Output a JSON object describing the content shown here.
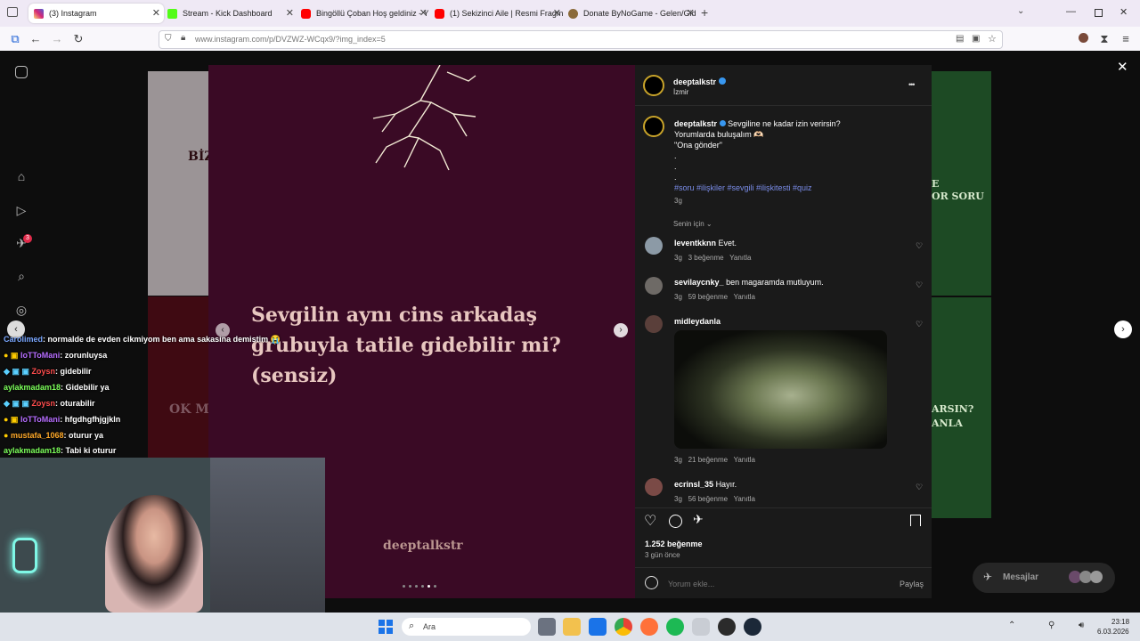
{
  "tabs": [
    {
      "label": "(3) Instagram",
      "icon": "instagram-icon",
      "color": "#d62976"
    },
    {
      "label": "Stream - Kick Dashboard",
      "icon": "kick-icon",
      "color": "#53fc18"
    },
    {
      "label": "Bingöllü Çoban Hoş geldiniz - Y",
      "icon": "youtube-icon",
      "color": "#ff0000"
    },
    {
      "label": "(1) Sekizinci Aile | Resmi Fragm",
      "icon": "youtube-icon",
      "color": "#ff0000"
    },
    {
      "label": "Donate ByNoGame - Gelen/Gid",
      "icon": "bynogame-icon",
      "color": "#8a6a3a"
    }
  ],
  "url": "www.instagram.com/p/DVZWZ-WCqx9/?img_index=5",
  "post": {
    "question": "Sevgilin aynı cins arkadaş grubuyla tatile gidebilir mi? (sensiz)",
    "brand": "deeptalkstr",
    "carousel_index": 5,
    "carousel_total": 6
  },
  "header": {
    "username": "deeptalkstr",
    "location": "İzmir",
    "more": "•••"
  },
  "caption": {
    "username": "deeptalkstr",
    "line1": "Sevgiline ne kadar izin verirsin?",
    "line2": "Yorumlarda buluşalım 🫶🏻",
    "line3": "\"Ona gönder\"",
    "dots": ".",
    "hashtags": "#soru #ilişkiler #sevgili #ilişkitesti #quiz",
    "age": "3g"
  },
  "filter": "Senin için",
  "comments": [
    {
      "user": "leventkknn",
      "text": "Evet.",
      "age": "3g",
      "likes": "3 beğenme",
      "reply": "Yanıtla"
    },
    {
      "user": "sevilaycnky_",
      "text": "ben magaramda mutluyum.",
      "age": "3g",
      "likes": "59 beğenme",
      "reply": "Yanıtla"
    },
    {
      "user": "midleydanla",
      "text": "",
      "age": "3g",
      "likes": "21 beğenme",
      "reply": "Yanıtla"
    },
    {
      "user": "ecrinsl_35",
      "text": "Hayır.",
      "age": "3g",
      "likes": "56 beğenme",
      "reply": "Yanıtla"
    }
  ],
  "likes": "1.252 beğenme",
  "posted": "3 gün önce",
  "comment_placeholder": "Yorum ekle...",
  "share_label": "Paylaş",
  "messages_label": "Mesajlar",
  "notification_count": "3",
  "chat": [
    {
      "user": "Carolimed",
      "msg": ": normalde de evden cikmiyom ben ama sakasina demistim 😭",
      "color": "#7aa7ff"
    },
    {
      "user": "IoTToMani",
      "msg": ": zorunluysa",
      "color": "#b66dff"
    },
    {
      "user": "Zoysn",
      "msg": ": gidebilir",
      "color": "#ff4d4d"
    },
    {
      "user": "aylakmadam18",
      "msg": ": Gidebilir ya",
      "color": "#7cff5a"
    },
    {
      "user": "Zoysn",
      "msg": ": oturabilir",
      "color": "#ff4d4d"
    },
    {
      "user": "IoTToMani",
      "msg": ": hfgdhgfhjgjkln",
      "color": "#b66dff"
    },
    {
      "user": "mustafa_1068",
      "msg": ": oturur ya",
      "color": "#ffa929"
    },
    {
      "user": "aylakmadam18",
      "msg": ": Tabi ki oturur",
      "color": "#7cff5a"
    }
  ],
  "bg_text": {
    "left_top": "BİZ",
    "left_bottom": "OK M",
    "right_top": "E\nOR SORU",
    "right_bottom": "ARSIN?\nANLA"
  },
  "taskbar": {
    "search": "Ara",
    "time": "23:18",
    "date": "6.03.2026"
  }
}
